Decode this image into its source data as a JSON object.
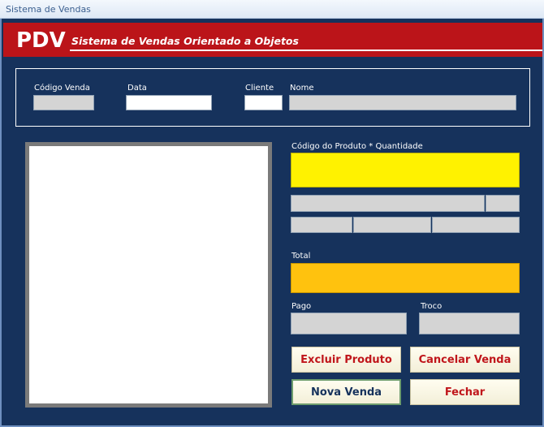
{
  "window": {
    "title": "Sistema de Vendas"
  },
  "banner": {
    "logo": "PDV",
    "subtitle": "Sistema de Vendas Orientado a Objetos"
  },
  "header": {
    "codigo_venda_label": "Código Venda",
    "data_label": "Data",
    "cliente_label": "Cliente",
    "nome_label": "Nome",
    "codigo_venda_value": "",
    "data_value": "",
    "cliente_value": "",
    "nome_value": ""
  },
  "produto": {
    "codigo_quantidade_label": "Código do Produto * Quantidade",
    "codigo_quantidade_value": ""
  },
  "totais": {
    "total_label": "Total",
    "pago_label": "Pago",
    "troco_label": "Troco",
    "total_value": "",
    "pago_value": "",
    "troco_value": ""
  },
  "buttons": {
    "excluir_produto": "Excluir Produto",
    "cancelar_venda": "Cancelar Venda",
    "nova_venda": "Nova Venda",
    "fechar": "Fechar"
  },
  "colors": {
    "form_background": "#16325c",
    "banner_red": "#bb1419",
    "product_input_yellow": "#fff200",
    "total_orange": "#ffc20e"
  }
}
